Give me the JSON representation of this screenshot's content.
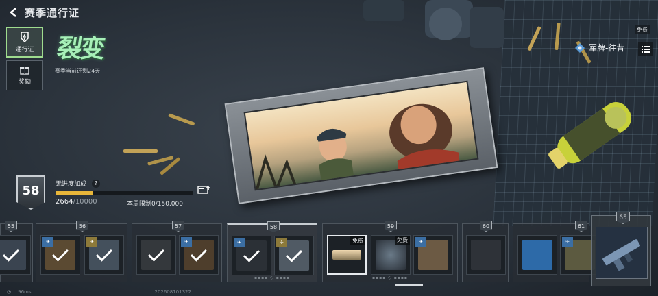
{
  "header": {
    "title": "赛季通行证"
  },
  "sidebar": {
    "items": [
      {
        "label": "通行证",
        "icon": "season-pass-icon",
        "active": true
      },
      {
        "label": "奖励",
        "icon": "gift-icon",
        "active": false
      }
    ]
  },
  "season": {
    "name": "裂变",
    "remaining": "赛季当前还剩24天"
  },
  "preview": {
    "free_tag": "免费",
    "item_name": "军牌-往昔",
    "item_icon": "dogtag-icon"
  },
  "progress": {
    "level": "58",
    "bonus_label": "无进度加成",
    "help": "?",
    "xp_current": "2664",
    "xp_total": "/10000",
    "xp_fraction": 0.2664,
    "weekly_limit": "本周限制0/150,000"
  },
  "track": {
    "levels": [
      "55",
      "56",
      "57",
      "58",
      "59",
      "60",
      "61",
      "65"
    ],
    "free_label": "免费"
  },
  "status": {
    "ping": "96ms",
    "uid": "202608101322"
  },
  "colors": {
    "accent": "#9fdc8e",
    "xp": "#e8b63a",
    "season_logo": "#a7f0b8"
  }
}
